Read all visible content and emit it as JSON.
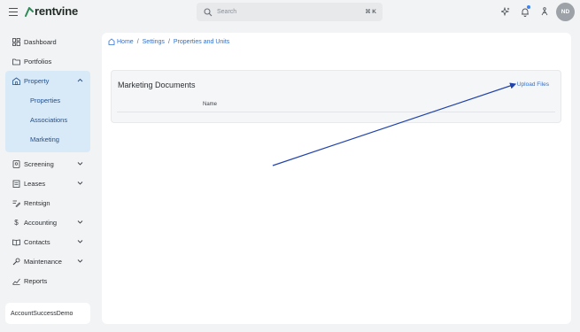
{
  "app": {
    "brand": "rentvine"
  },
  "search": {
    "placeholder": "Search",
    "shortcut": "⌘ K"
  },
  "user": {
    "initials": "ND"
  },
  "sidebar": {
    "items": [
      {
        "label": "Dashboard",
        "icon": "dashboard-icon"
      },
      {
        "label": "Portfolios",
        "icon": "folder-icon"
      },
      {
        "label": "Property",
        "icon": "property-icon",
        "expanded": true
      },
      {
        "label": "Screening",
        "icon": "screening-icon"
      },
      {
        "label": "Leases",
        "icon": "lease-icon"
      },
      {
        "label": "Rentsign",
        "icon": "signature-icon"
      },
      {
        "label": "Accounting",
        "icon": "dollar-icon"
      },
      {
        "label": "Contacts",
        "icon": "contacts-icon"
      },
      {
        "label": "Maintenance",
        "icon": "wrench-icon"
      },
      {
        "label": "Reports",
        "icon": "reports-icon"
      }
    ],
    "property_sub": [
      {
        "label": "Properties"
      },
      {
        "label": "Associations"
      },
      {
        "label": "Marketing"
      }
    ],
    "account": "AccountSuccessDemo"
  },
  "breadcrumb": {
    "home": "Home",
    "settings": "Settings",
    "current": "Properties and Units"
  },
  "card": {
    "title": "Marketing Documents",
    "upload_label": "Upload Files",
    "columns": [
      "Name"
    ]
  },
  "colors": {
    "accent": "#2f6fcf",
    "active_bg": "#d8e9f7",
    "arrow": "#2244aa",
    "brand_green": "#2e8b57"
  }
}
